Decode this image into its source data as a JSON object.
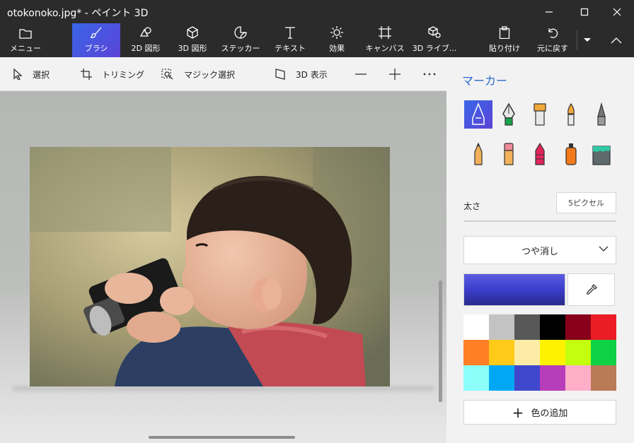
{
  "window": {
    "title": "otokonoko.jpg* - ペイント 3D"
  },
  "ribbon": {
    "menu": "メニュー",
    "brush": "ブラシ",
    "shapes2d": "2D 図形",
    "shapes3d": "3D 図形",
    "sticker": "ステッカー",
    "text": "テキスト",
    "effects": "効果",
    "canvas": "キャンバス",
    "library3d": "3D ライブ...",
    "paste": "貼り付け",
    "undo": "元に戻す"
  },
  "toolbar": {
    "select": "選択",
    "crop": "トリミング",
    "magic_select": "マジック選択",
    "view3d": "3D 表示"
  },
  "panel": {
    "title": "マーカー",
    "tools": [
      "marker-icon",
      "calligraphy-pen-icon",
      "oil-brush-icon",
      "watercolor-icon",
      "pixel-pen-icon",
      "pencil-icon",
      "eraser-icon",
      "crayon-icon",
      "spray-can-icon",
      "fill-bucket-icon"
    ],
    "size_label": "太さ",
    "size_value": "5ピクセル",
    "finish": "つや消し",
    "palette": [
      "#ffffff",
      "#c3c3c3",
      "#585858",
      "#000000",
      "#88001b",
      "#ec1c24",
      "#ff7f27",
      "#ffca18",
      "#fdeca6",
      "#fff200",
      "#c4ff0e",
      "#0ed145",
      "#8cfffb",
      "#00a8f3",
      "#3f48cc",
      "#b83dba",
      "#ffaec8",
      "#b97a56"
    ],
    "selected_color": "#3f48cc",
    "add_color": "色の追加"
  }
}
